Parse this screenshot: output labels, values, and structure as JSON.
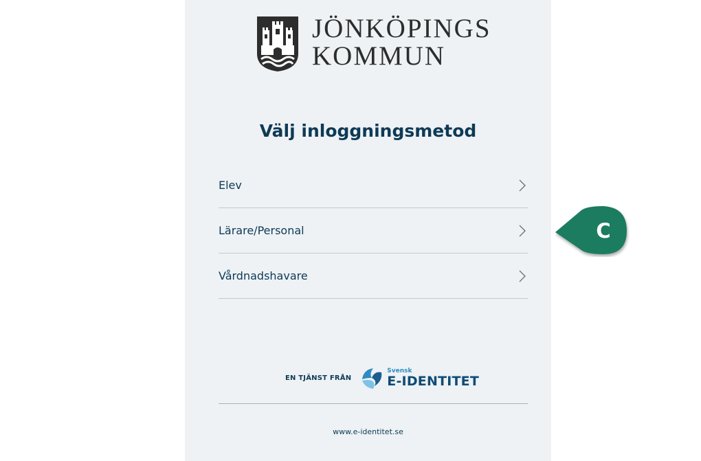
{
  "brand": {
    "line1": "JÖNKÖPINGS",
    "line2": "KOMMUN",
    "crest_icon": "castle-crest-icon"
  },
  "heading": "Välj inloggningsmetod",
  "methods": [
    {
      "label": "Elev",
      "icon": "chevron-right-icon"
    },
    {
      "label": "Lärare/Personal",
      "icon": "chevron-right-icon"
    },
    {
      "label": "Vårdnadshavare",
      "icon": "chevron-right-icon"
    }
  ],
  "provider": {
    "prefix": "EN TJÄNST FRÅN",
    "brand_small": "Svensk",
    "brand_big": "E-IDENTITET",
    "logo_icon": "svensk-e-identitet-logo"
  },
  "footer": {
    "link": "www.e-identitet.se"
  },
  "annotation": {
    "letter": "C",
    "color": "#1b7c5e"
  },
  "colors": {
    "panel_bg": "#eef2f5",
    "text_primary": "#0e3a55",
    "divider": "#c3c9ce"
  }
}
